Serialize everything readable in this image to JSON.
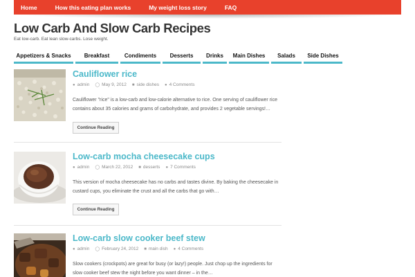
{
  "top_nav": {
    "items": [
      {
        "label": "Home"
      },
      {
        "label": "How this eating plan works"
      },
      {
        "label": "My weight loss story"
      },
      {
        "label": "FAQ"
      }
    ],
    "bar_color": "#e8412c"
  },
  "site": {
    "title": "Low Carb And Slow Carb Recipes",
    "tagline": "Eat low-carb. Eat lean slow-carbs. Lose weight."
  },
  "category_nav": {
    "items": [
      {
        "label": "Appetizers & Snacks"
      },
      {
        "label": "Breakfast"
      },
      {
        "label": "Condiments"
      },
      {
        "label": "Desserts"
      },
      {
        "label": "Drinks"
      },
      {
        "label": "Main Dishes"
      },
      {
        "label": "Salads"
      },
      {
        "label": "Side Dishes"
      }
    ],
    "accent_color": "#4bb8c9"
  },
  "posts": [
    {
      "title": "Cauliflower rice",
      "author": "admin",
      "date": "May 9, 2012",
      "category": "side dishes",
      "comments": "4 Comments",
      "excerpt": "Cauliflower \"rice\" is a low-carb and low-calorie alternative to rice. One serving of cauliflower rice contains about 35 calories and grams of carbohydrate, and provides 2 vegetable servings!…",
      "continue_label": "Continue Reading",
      "thumbnail_icon": "cauliflower-rice-photo"
    },
    {
      "title": "Low-carb mocha cheesecake cups",
      "author": "admin",
      "date": "March 22, 2012",
      "category": "desserts",
      "comments": "7 Comments",
      "excerpt": "This version of mocha cheesecake has no carbs and tastes divine. By baking the cheesecake in custard cups, you eliminate the crust and all the carbs that go with…",
      "continue_label": "Continue Reading",
      "thumbnail_icon": "cheesecake-cup-photo"
    },
    {
      "title": "Low-carb slow cooker beef stew",
      "author": "admin",
      "date": "February 24, 2012",
      "category": "main dish",
      "comments": "4 Comments",
      "excerpt": "Slow cookers  (crockpots) are great for busy (or lazy!) people. Just chop up the ingredients for slow cooker beef stew the night before you want dinner – in the…",
      "continue_label": "",
      "thumbnail_icon": "beef-stew-photo"
    }
  ],
  "meta_icons": {
    "author": "user-icon",
    "date": "clock-icon",
    "category": "folder-icon",
    "comments": "comment-icon"
  }
}
